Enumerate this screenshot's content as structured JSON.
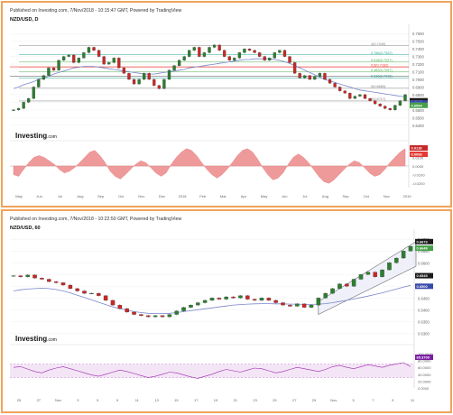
{
  "panels": [
    {
      "header": "Published on Investing.com, 7/Nov/2018 - 10:15:47 GMT, Powered by TradingView",
      "symbol": "NZD/USD, D",
      "logo": "Investing.com"
    },
    {
      "header": "Published on Investing.com, 7/Nov/2018 - 10:22:50 GMT, Powered by TradingView",
      "symbol": "NZD/USD, 60",
      "logo": "Investing.com"
    }
  ],
  "chart_data": [
    {
      "type": "line",
      "title": "NZD/USD, D",
      "x_ticks": [
        "May",
        "Jun",
        "Jul",
        "Aug",
        "Sep",
        "Oct",
        "Nov",
        "Dec",
        "2018",
        "Feb",
        "Mar",
        "Apr",
        "May",
        "Jun",
        "Jul",
        "Aug",
        "Sep",
        "Oct",
        "Nov",
        "2019"
      ],
      "price_axis": [
        "0.7600",
        "0.7500",
        "0.7400",
        "0.7300",
        "0.7200",
        "0.7100",
        "0.7000",
        "0.6900",
        "0.6800",
        "0.6700",
        "0.6600",
        "0.6500",
        "0.6400"
      ],
      "ylim": [
        0.635,
        0.765
      ],
      "series": [
        {
          "values": [
            0.66,
            0.662,
            0.67,
            0.675,
            0.69,
            0.7,
            0.705,
            0.715,
            0.712,
            0.725,
            0.73,
            0.732,
            0.722,
            0.728,
            0.735,
            0.742,
            0.738,
            0.73,
            0.72,
            0.722,
            0.728,
            0.715,
            0.708,
            0.7,
            0.694,
            0.7,
            0.708,
            0.7,
            0.692,
            0.688,
            0.7,
            0.712,
            0.718,
            0.725,
            0.73,
            0.738,
            0.742,
            0.73,
            0.735,
            0.742,
            0.745,
            0.738,
            0.73,
            0.725,
            0.728,
            0.735,
            0.74,
            0.738,
            0.735,
            0.73,
            0.725,
            0.728,
            0.735,
            0.738,
            0.73,
            0.722,
            0.708,
            0.702,
            0.705,
            0.7,
            0.704,
            0.708,
            0.7,
            0.695,
            0.69,
            0.685,
            0.682,
            0.675,
            0.678,
            0.68,
            0.675,
            0.672,
            0.668,
            0.665,
            0.662,
            0.66,
            0.666,
            0.672,
            0.68
          ]
        },
        {
          "values": [
            0.688,
            0.69,
            0.693,
            0.695,
            0.697,
            0.7,
            0.702,
            0.704,
            0.707,
            0.709,
            0.711,
            0.713,
            0.715,
            0.716,
            0.717,
            0.717,
            0.717,
            0.716,
            0.715,
            0.714,
            0.713,
            0.712,
            0.711,
            0.71,
            0.709,
            0.708,
            0.707,
            0.707,
            0.707,
            0.708,
            0.709,
            0.71,
            0.711,
            0.712,
            0.713,
            0.715,
            0.716,
            0.717,
            0.718,
            0.719,
            0.72,
            0.721,
            0.722,
            0.723,
            0.724,
            0.725,
            0.726,
            0.726,
            0.727,
            0.727,
            0.727,
            0.727,
            0.726,
            0.725,
            0.723,
            0.721,
            0.718,
            0.715,
            0.712,
            0.709,
            0.706,
            0.703,
            0.7,
            0.698,
            0.696,
            0.694,
            0.692,
            0.69,
            0.688,
            0.686,
            0.685,
            0.684,
            0.683,
            0.682,
            0.681,
            0.68,
            0.679,
            0.678,
            0.677
          ]
        }
      ],
      "fib_levels": [
        {
          "label": "1(0.7440)",
          "value": 0.744,
          "color": "#808080"
        },
        {
          "label": "0.786(0.7322)",
          "value": 0.7322,
          "color": "#26a69a"
        },
        {
          "label": "0.618(0.7227)",
          "value": 0.7227,
          "color": "#4caf50"
        },
        {
          "label": "0.5(0.7162)",
          "value": 0.7162,
          "color": "#f44336"
        },
        {
          "label": "0.382(0.7097)",
          "value": 0.7097,
          "color": "#4caf50"
        },
        {
          "label": "0.236(0.7015)",
          "value": 0.7015,
          "color": "#26a69a"
        },
        {
          "label": "0(0.6883)",
          "value": 0.6883,
          "color": "#808080"
        },
        {
          "label": "0(0.6717)",
          "value": 0.6717,
          "color": "#808080"
        }
      ],
      "hlines": [
        {
          "value": 0.7165,
          "color": "#e53935"
        },
        {
          "value": 0.704,
          "color": "#444444"
        }
      ],
      "price_tags": [
        {
          "label": "0.6647",
          "value": 0.672,
          "color": "#1a1a1a"
        },
        {
          "label": "0.6612",
          "value": 0.669,
          "color": "#3949ab"
        },
        {
          "label": "0.6594",
          "value": 0.666,
          "color": "#43a047"
        }
      ],
      "indicator": {
        "values": [
          -0.01,
          -0.012,
          -0.004,
          0.004,
          0.01,
          0.012,
          0.01,
          0.006,
          0.002,
          -0.004,
          -0.008,
          -0.006,
          -0.002,
          0.004,
          0.01,
          0.016,
          0.018,
          0.012,
          0.004,
          -0.006,
          -0.012,
          -0.015,
          -0.01,
          -0.004,
          0.002,
          0.006,
          0.004,
          -0.002,
          -0.008,
          -0.012,
          -0.008,
          0.002,
          0.01,
          0.016,
          0.02,
          0.018,
          0.012,
          0.004,
          -0.004,
          -0.01,
          -0.014,
          -0.01,
          -0.004,
          0.004,
          0.012,
          0.018,
          0.02,
          0.016,
          0.008,
          -0.002,
          -0.01,
          -0.016,
          -0.014,
          -0.008,
          0.002,
          0.01,
          0.014,
          0.01,
          0.004,
          -0.004,
          -0.012,
          -0.018,
          -0.02,
          -0.016,
          -0.01,
          -0.004,
          0.002,
          0.006,
          0.004,
          -0.002,
          -0.008,
          -0.012,
          -0.01,
          -0.004,
          0.004,
          0.01,
          0.016,
          0.02
        ],
        "axis": [
          "0.0200",
          "0.0100",
          "0.0000",
          "-0.0100",
          "-0.0200"
        ],
        "ylim": [
          -0.025,
          0.025
        ],
        "tags": [
          {
            "label": "0.0118",
            "color": "#c62828"
          },
          {
            "label": "0.0096",
            "color": "#e53935"
          }
        ]
      }
    },
    {
      "type": "line",
      "title": "NZD/USD, 60",
      "x_ticks": [
        "25",
        "27",
        "Nov",
        "3",
        "5",
        "9",
        "11",
        "13",
        "15",
        "17",
        "19",
        "21",
        "23",
        "25",
        "27",
        "29",
        "Nov",
        "5",
        "7",
        "9",
        "11"
      ],
      "price_axis": [
        "0.6700",
        "0.6650",
        "0.6600",
        "0.6550",
        "0.6500",
        "0.6450",
        "0.6400",
        "0.6350",
        "0.6300"
      ],
      "ylim": [
        0.629,
        0.672
      ],
      "series": [
        {
          "values": [
            0.6545,
            0.654,
            0.6548,
            0.6535,
            0.653,
            0.652,
            0.6515,
            0.6505,
            0.649,
            0.648,
            0.647,
            0.647,
            0.646,
            0.644,
            0.642,
            0.6405,
            0.639,
            0.638,
            0.6375,
            0.637,
            0.6375,
            0.637,
            0.638,
            0.6395,
            0.641,
            0.642,
            0.643,
            0.644,
            0.645,
            0.6445,
            0.6455,
            0.645,
            0.646,
            0.6445,
            0.644,
            0.645,
            0.644,
            0.643,
            0.642,
            0.6415,
            0.6425,
            0.641,
            0.642,
            0.645,
            0.647,
            0.649,
            0.651,
            0.65,
            0.653,
            0.655,
            0.656,
            0.654,
            0.657,
            0.66,
            0.662,
            0.665,
            0.667
          ]
        },
        {
          "values": [
            0.648,
            0.6485,
            0.6488,
            0.649,
            0.6492,
            0.649,
            0.6486,
            0.648,
            0.6472,
            0.6462,
            0.6452,
            0.6442,
            0.6432,
            0.6422,
            0.6412,
            0.6405,
            0.6398,
            0.6392,
            0.6388,
            0.6385,
            0.6384,
            0.6384,
            0.6385,
            0.6388,
            0.6392,
            0.6396,
            0.64,
            0.6404,
            0.6408,
            0.6412,
            0.6416,
            0.642,
            0.6422,
            0.6424,
            0.6425,
            0.6426,
            0.6426,
            0.6425,
            0.6425,
            0.6424,
            0.6424,
            0.6423,
            0.6423,
            0.6424,
            0.6426,
            0.643,
            0.6435,
            0.644,
            0.6446,
            0.6452,
            0.6458,
            0.6465,
            0.6472,
            0.648,
            0.6488,
            0.6496,
            0.6504
          ]
        }
      ],
      "channel": {
        "upper": [
          0.6435,
          0.669
        ],
        "lower": [
          0.638,
          0.6585
        ]
      },
      "price_tags": [
        {
          "label": "0.6673",
          "value": 0.669,
          "color": "#1a1a1a"
        },
        {
          "label": "0.6648",
          "value": 0.6662,
          "color": "#43a047"
        },
        {
          "label": "0.6545",
          "value": 0.6545,
          "color": "#1a1a1a"
        },
        {
          "label": "0.6500",
          "value": 0.65,
          "color": "#3949ab"
        }
      ],
      "indicator": {
        "values": [
          60,
          62,
          55,
          48,
          44,
          52,
          58,
          62,
          56,
          50,
          44,
          38,
          34,
          40,
          46,
          52,
          48,
          42,
          36,
          30,
          34,
          40,
          46,
          44,
          38,
          32,
          28,
          34,
          40,
          48,
          54,
          50,
          46,
          52,
          58,
          56,
          50,
          44,
          48,
          54,
          60,
          56,
          52,
          48,
          54,
          62,
          66,
          60,
          56,
          62,
          68,
          64,
          60,
          66,
          70,
          74,
          62
        ],
        "axis": [
          "100.0000",
          "80.0000",
          "60.0000",
          "40.0000",
          "20.0000",
          "0.0000"
        ],
        "ylim": [
          0,
          100
        ],
        "band": [
          30,
          70
        ],
        "tags": [
          {
            "label": "65.3700",
            "color": "#7b1fa2"
          }
        ]
      }
    }
  ]
}
